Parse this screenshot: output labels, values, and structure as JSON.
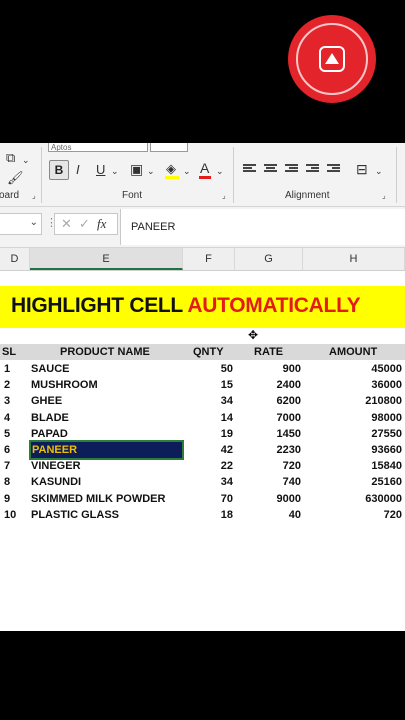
{
  "record_button": {
    "icon": "record-upload-icon",
    "color": "#e3242b"
  },
  "ribbon": {
    "font_name": "Aptos",
    "groups": [
      {
        "label": "oard"
      },
      {
        "label": "Font"
      },
      {
        "label": "Alignment"
      }
    ],
    "bold_label": "B",
    "italic_label": "I",
    "underline_label": "U",
    "font_color_label": "A"
  },
  "formula_bar": {
    "name_box": "",
    "fx_label": "fx",
    "content": "PANEER"
  },
  "columns": [
    "D",
    "E",
    "F",
    "G",
    "H"
  ],
  "banner": {
    "text_black": "HIGHLIGHT CELL ",
    "text_red": "AUTOMATICALLY",
    "background": "#ffff00"
  },
  "table": {
    "headers": [
      "SL",
      "PRODUCT NAME",
      "QNTY",
      "RATE",
      "AMOUNT"
    ],
    "rows": [
      {
        "sl": "1",
        "name": "SAUCE",
        "qnty": "50",
        "rate": "900",
        "amount": "45000"
      },
      {
        "sl": "2",
        "name": "MUSHROOM",
        "qnty": "15",
        "rate": "2400",
        "amount": "36000"
      },
      {
        "sl": "3",
        "name": "GHEE",
        "qnty": "34",
        "rate": "6200",
        "amount": "210800"
      },
      {
        "sl": "4",
        "name": "BLADE",
        "qnty": "14",
        "rate": "7000",
        "amount": "98000"
      },
      {
        "sl": "5",
        "name": "PAPAD",
        "qnty": "19",
        "rate": "1450",
        "amount": "27550"
      },
      {
        "sl": "6",
        "name": "PANEER",
        "qnty": "42",
        "rate": "2230",
        "amount": "93660"
      },
      {
        "sl": "7",
        "name": "VINEGER",
        "qnty": "22",
        "rate": "720",
        "amount": "15840"
      },
      {
        "sl": "8",
        "name": "KASUNDI",
        "qnty": "34",
        "rate": "740",
        "amount": "25160"
      },
      {
        "sl": "9",
        "name": "SKIMMED MILK POWDER",
        "qnty": "70",
        "rate": "9000",
        "amount": "630000"
      },
      {
        "sl": "10",
        "name": "PLASTIC GLASS",
        "qnty": "18",
        "rate": "40",
        "amount": "720"
      }
    ],
    "selected_row": 5,
    "highlight_color": "#0d1d5a",
    "highlight_text_color": "#f0c000"
  }
}
